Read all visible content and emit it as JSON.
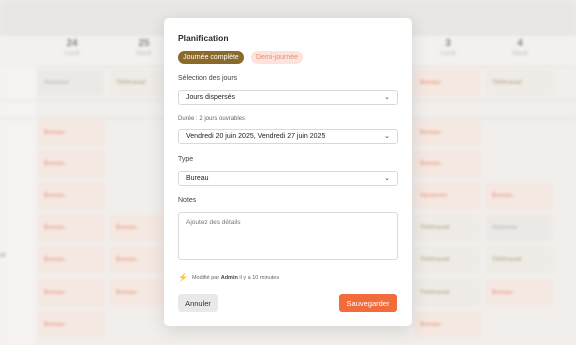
{
  "background": {
    "days": [
      {
        "num": "24",
        "weekday": "Lundi"
      },
      {
        "num": "25",
        "weekday": "Mardi"
      },
      {
        "num": "3",
        "weekday": "Lundi"
      },
      {
        "num": "4",
        "weekday": "Mardi"
      }
    ],
    "cells": {
      "absence": "Absence",
      "teletravail": "Télétravail",
      "bureau": "Bureau",
      "vacances": "Vacances"
    },
    "side_letter": "ar"
  },
  "modal": {
    "title": "Planification",
    "toggle_full": "Journée complète",
    "toggle_half": "Demi-journée",
    "days_label": "Sélection des jours",
    "days_value": "Jours dispersés",
    "duration_label": "Durée : 2 jours ouvrables",
    "duration_value": "Vendredi 20 juin 2025, Vendredi 27 juin 2025",
    "type_label": "Type",
    "type_value": "Bureau",
    "notes_label": "Notes",
    "notes_placeholder": "Ajoutez des détails",
    "modified_prefix": "Modifié par",
    "modified_user": "Admin",
    "modified_suffix": "il y a 10 minutes",
    "cancel_label": "Annuler",
    "save_label": "Sauvegarder"
  },
  "colors": {
    "accent": "#f26b3a",
    "brown": "#8a6a2a"
  }
}
